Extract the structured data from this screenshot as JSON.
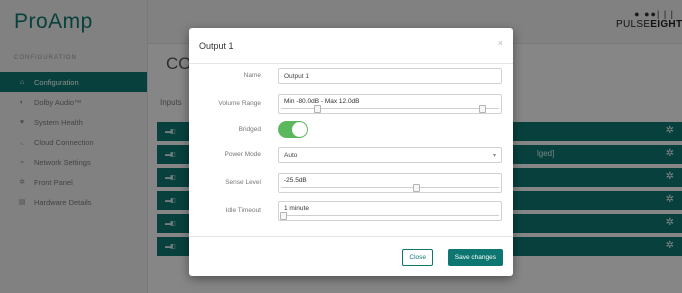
{
  "app": {
    "brand": "ProAmp"
  },
  "sidebar": {
    "section_header": "CONFIGURATION",
    "items": [
      {
        "label": "Configuration",
        "icon": "home-icon",
        "active": true
      },
      {
        "label": "Dolby Audio™",
        "icon": "dolby-icon",
        "active": false
      },
      {
        "label": "System Health",
        "icon": "heart-icon",
        "active": false
      },
      {
        "label": "Cloud Connection",
        "icon": "wifi-icon",
        "active": false
      },
      {
        "label": "Network Settings",
        "icon": "network-icon",
        "active": false
      },
      {
        "label": "Front Panel",
        "icon": "gear-icon",
        "active": false
      },
      {
        "label": "Hardware Details",
        "icon": "hardware-icon",
        "active": false
      }
    ]
  },
  "header": {
    "logo_top": "● ●●| | |",
    "logo_word_light": "PULSE",
    "logo_word_bold": "EIGHT"
  },
  "main": {
    "title": "CO",
    "inputs_label": "Inputs",
    "row_suffix": "lged]"
  },
  "modal": {
    "title": "Output 1",
    "close_glyph": "×",
    "fields": {
      "name": {
        "label": "Name",
        "value": "Output 1"
      },
      "volume_range": {
        "label": "Volume Range",
        "value": "Min -80.0dB - Max 12.0dB",
        "min_fraction": 0.16,
        "max_fraction": 0.93
      },
      "bridged": {
        "label": "Bridged",
        "value": true
      },
      "power_mode": {
        "label": "Power Mode",
        "value": "Auto"
      },
      "sense_level": {
        "label": "Sense Level",
        "value": "-25.5dB",
        "fraction": 0.62
      },
      "idle_timeout": {
        "label": "Idle Timeout",
        "value": "1 minute",
        "fraction": 0.0
      }
    },
    "buttons": {
      "close": "Close",
      "save": "Save changes"
    }
  },
  "colors": {
    "accent": "#0d7670",
    "toggle_on": "#5cb85c"
  }
}
